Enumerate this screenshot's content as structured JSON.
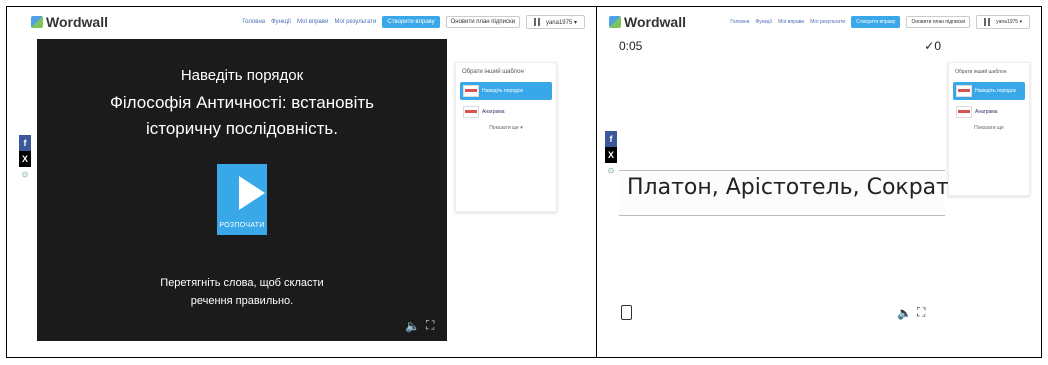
{
  "left": {
    "logo": "Wordwall",
    "nav": [
      "Головна",
      "Функції",
      "Мої вправи",
      "Мої результати"
    ],
    "create_button": "Створити вправу",
    "upgrade_button": "Оновити план підписки",
    "user_label": "yana1975 ▾",
    "game": {
      "pretitle": "Наведіть порядок",
      "title": "Філософія Античності: встановіть історичну послідовність.",
      "start_label": "РОЗПОЧАТИ",
      "instruction": "Перетягніть слова, щоб скласти речення правильно."
    },
    "sidebar": {
      "header": "Обрати інший шаблон",
      "templates": [
        "Наведіть порядок",
        "Анаграма"
      ],
      "more": "Показати ще ▾"
    }
  },
  "right": {
    "logo": "Wordwall",
    "nav": [
      "Головна",
      "Функції",
      "Мої вправи",
      "Мої результати"
    ],
    "create_button": "Створити вправу",
    "upgrade_button": "Оновити план підписки",
    "user_label": "yana1975 ▾",
    "game": {
      "timer": "0:05",
      "score": "✓0",
      "sentence": "Платон, Арістотель, Сократ"
    },
    "sidebar": {
      "header": "Обрати інший шаблон",
      "templates": [
        "Наведіть порядок",
        "Анаграма"
      ],
      "more": "Показати ще"
    }
  },
  "icons": {
    "facebook": "f",
    "x": "X",
    "volume": "🔈",
    "fullscreen": "⛶"
  },
  "colors": {
    "accent": "#38a8e8",
    "game_bg": "#1b1b1b",
    "facebook": "#3b5998"
  }
}
